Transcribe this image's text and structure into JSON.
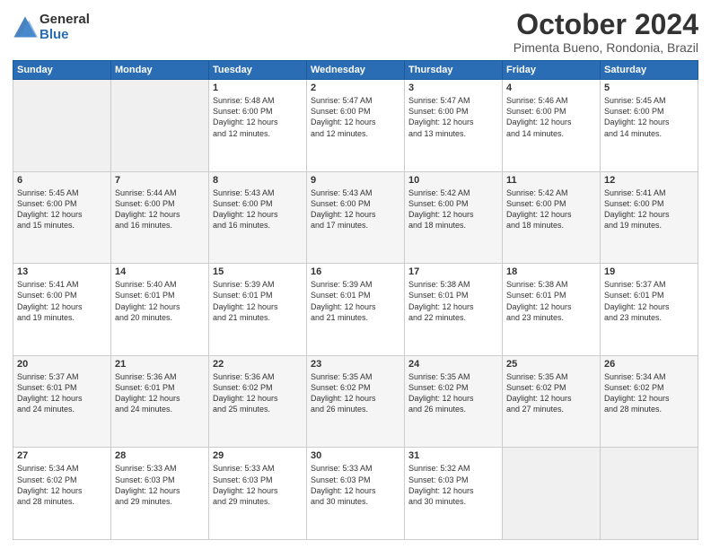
{
  "logo": {
    "general": "General",
    "blue": "Blue"
  },
  "header": {
    "month": "October 2024",
    "location": "Pimenta Bueno, Rondonia, Brazil"
  },
  "days_of_week": [
    "Sunday",
    "Monday",
    "Tuesday",
    "Wednesday",
    "Thursday",
    "Friday",
    "Saturday"
  ],
  "weeks": [
    [
      {
        "day": "",
        "info": ""
      },
      {
        "day": "",
        "info": ""
      },
      {
        "day": "1",
        "info": "Sunrise: 5:48 AM\nSunset: 6:00 PM\nDaylight: 12 hours\nand 12 minutes."
      },
      {
        "day": "2",
        "info": "Sunrise: 5:47 AM\nSunset: 6:00 PM\nDaylight: 12 hours\nand 12 minutes."
      },
      {
        "day": "3",
        "info": "Sunrise: 5:47 AM\nSunset: 6:00 PM\nDaylight: 12 hours\nand 13 minutes."
      },
      {
        "day": "4",
        "info": "Sunrise: 5:46 AM\nSunset: 6:00 PM\nDaylight: 12 hours\nand 14 minutes."
      },
      {
        "day": "5",
        "info": "Sunrise: 5:45 AM\nSunset: 6:00 PM\nDaylight: 12 hours\nand 14 minutes."
      }
    ],
    [
      {
        "day": "6",
        "info": "Sunrise: 5:45 AM\nSunset: 6:00 PM\nDaylight: 12 hours\nand 15 minutes."
      },
      {
        "day": "7",
        "info": "Sunrise: 5:44 AM\nSunset: 6:00 PM\nDaylight: 12 hours\nand 16 minutes."
      },
      {
        "day": "8",
        "info": "Sunrise: 5:43 AM\nSunset: 6:00 PM\nDaylight: 12 hours\nand 16 minutes."
      },
      {
        "day": "9",
        "info": "Sunrise: 5:43 AM\nSunset: 6:00 PM\nDaylight: 12 hours\nand 17 minutes."
      },
      {
        "day": "10",
        "info": "Sunrise: 5:42 AM\nSunset: 6:00 PM\nDaylight: 12 hours\nand 18 minutes."
      },
      {
        "day": "11",
        "info": "Sunrise: 5:42 AM\nSunset: 6:00 PM\nDaylight: 12 hours\nand 18 minutes."
      },
      {
        "day": "12",
        "info": "Sunrise: 5:41 AM\nSunset: 6:00 PM\nDaylight: 12 hours\nand 19 minutes."
      }
    ],
    [
      {
        "day": "13",
        "info": "Sunrise: 5:41 AM\nSunset: 6:00 PM\nDaylight: 12 hours\nand 19 minutes."
      },
      {
        "day": "14",
        "info": "Sunrise: 5:40 AM\nSunset: 6:01 PM\nDaylight: 12 hours\nand 20 minutes."
      },
      {
        "day": "15",
        "info": "Sunrise: 5:39 AM\nSunset: 6:01 PM\nDaylight: 12 hours\nand 21 minutes."
      },
      {
        "day": "16",
        "info": "Sunrise: 5:39 AM\nSunset: 6:01 PM\nDaylight: 12 hours\nand 21 minutes."
      },
      {
        "day": "17",
        "info": "Sunrise: 5:38 AM\nSunset: 6:01 PM\nDaylight: 12 hours\nand 22 minutes."
      },
      {
        "day": "18",
        "info": "Sunrise: 5:38 AM\nSunset: 6:01 PM\nDaylight: 12 hours\nand 23 minutes."
      },
      {
        "day": "19",
        "info": "Sunrise: 5:37 AM\nSunset: 6:01 PM\nDaylight: 12 hours\nand 23 minutes."
      }
    ],
    [
      {
        "day": "20",
        "info": "Sunrise: 5:37 AM\nSunset: 6:01 PM\nDaylight: 12 hours\nand 24 minutes."
      },
      {
        "day": "21",
        "info": "Sunrise: 5:36 AM\nSunset: 6:01 PM\nDaylight: 12 hours\nand 24 minutes."
      },
      {
        "day": "22",
        "info": "Sunrise: 5:36 AM\nSunset: 6:02 PM\nDaylight: 12 hours\nand 25 minutes."
      },
      {
        "day": "23",
        "info": "Sunrise: 5:35 AM\nSunset: 6:02 PM\nDaylight: 12 hours\nand 26 minutes."
      },
      {
        "day": "24",
        "info": "Sunrise: 5:35 AM\nSunset: 6:02 PM\nDaylight: 12 hours\nand 26 minutes."
      },
      {
        "day": "25",
        "info": "Sunrise: 5:35 AM\nSunset: 6:02 PM\nDaylight: 12 hours\nand 27 minutes."
      },
      {
        "day": "26",
        "info": "Sunrise: 5:34 AM\nSunset: 6:02 PM\nDaylight: 12 hours\nand 28 minutes."
      }
    ],
    [
      {
        "day": "27",
        "info": "Sunrise: 5:34 AM\nSunset: 6:02 PM\nDaylight: 12 hours\nand 28 minutes."
      },
      {
        "day": "28",
        "info": "Sunrise: 5:33 AM\nSunset: 6:03 PM\nDaylight: 12 hours\nand 29 minutes."
      },
      {
        "day": "29",
        "info": "Sunrise: 5:33 AM\nSunset: 6:03 PM\nDaylight: 12 hours\nand 29 minutes."
      },
      {
        "day": "30",
        "info": "Sunrise: 5:33 AM\nSunset: 6:03 PM\nDaylight: 12 hours\nand 30 minutes."
      },
      {
        "day": "31",
        "info": "Sunrise: 5:32 AM\nSunset: 6:03 PM\nDaylight: 12 hours\nand 30 minutes."
      },
      {
        "day": "",
        "info": ""
      },
      {
        "day": "",
        "info": ""
      }
    ]
  ]
}
